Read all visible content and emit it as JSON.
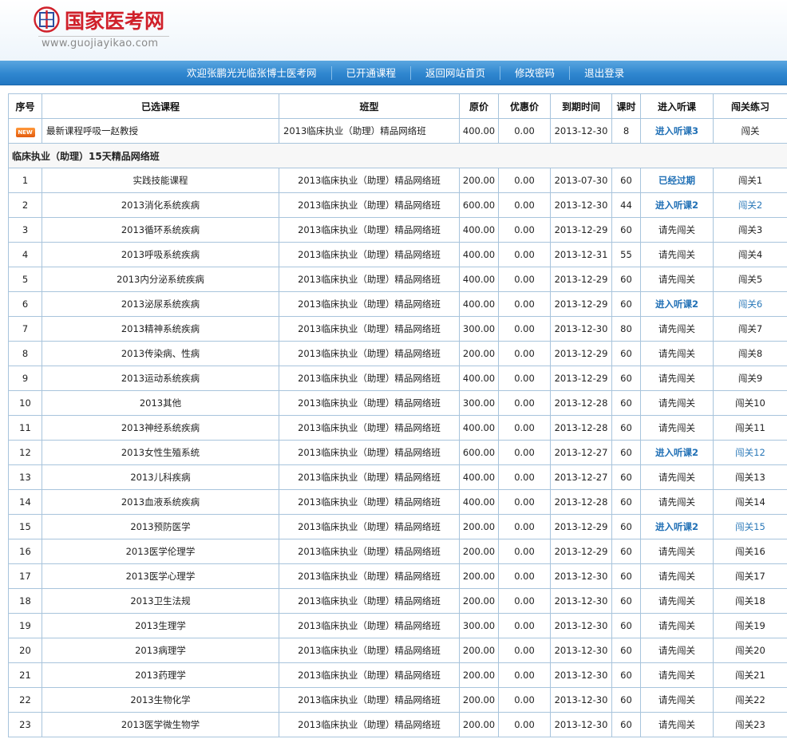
{
  "logo": {
    "title": "国家医考网",
    "url_text": "www.guojiayikao.com"
  },
  "nav": {
    "items": [
      {
        "label": "欢迎张鹏光光临张博士医考网"
      },
      {
        "label": "已开通课程"
      },
      {
        "label": "返回网站首页"
      },
      {
        "label": "修改密码"
      },
      {
        "label": "退出登录"
      }
    ]
  },
  "colors": {
    "nav_blue": "#2f86cf",
    "link_blue": "#1f6fb5",
    "logo_red": "#d0202a",
    "border": "#a8c4dc"
  },
  "table": {
    "headers": [
      "序号",
      "已选课程",
      "班型",
      "原价",
      "优惠价",
      "到期时间",
      "课时",
      "进入听课",
      "闯关练习"
    ],
    "featured": {
      "badge": "NEW",
      "course": "最新课程呼吸一赵教授",
      "class": "2013临床执业（助理）精品网络班",
      "price": "400.00",
      "discount": "0.00",
      "expiry": "2013-12-30",
      "hours": "8",
      "enter": "进入听课3",
      "gate": "闯关"
    },
    "section_title": "临床执业（助理）15天精品网络班",
    "rows": [
      {
        "no": "1",
        "course": "实践技能课程",
        "class": "2013临床执业（助理）精品网络班",
        "price": "200.00",
        "discount": "0.00",
        "expiry": "2013-07-30",
        "hours": "60",
        "enter": "已经过期",
        "gate": "闯关1"
      },
      {
        "no": "2",
        "course": "2013消化系统疾病",
        "class": "2013临床执业（助理）精品网络班",
        "price": "600.00",
        "discount": "0.00",
        "expiry": "2013-12-30",
        "hours": "44",
        "enter": "进入听课2",
        "gate": "闯关2"
      },
      {
        "no": "3",
        "course": "2013循环系统疾病",
        "class": "2013临床执业（助理）精品网络班",
        "price": "400.00",
        "discount": "0.00",
        "expiry": "2013-12-29",
        "hours": "60",
        "enter": "请先闯关",
        "gate": "闯关3"
      },
      {
        "no": "4",
        "course": "2013呼吸系统疾病",
        "class": "2013临床执业（助理）精品网络班",
        "price": "400.00",
        "discount": "0.00",
        "expiry": "2013-12-31",
        "hours": "55",
        "enter": "请先闯关",
        "gate": "闯关4"
      },
      {
        "no": "5",
        "course": "2013内分泌系统疾病",
        "class": "2013临床执业（助理）精品网络班",
        "price": "400.00",
        "discount": "0.00",
        "expiry": "2013-12-29",
        "hours": "60",
        "enter": "请先闯关",
        "gate": "闯关5"
      },
      {
        "no": "6",
        "course": "2013泌尿系统疾病",
        "class": "2013临床执业（助理）精品网络班",
        "price": "400.00",
        "discount": "0.00",
        "expiry": "2013-12-29",
        "hours": "60",
        "enter": "进入听课2",
        "gate": "闯关6"
      },
      {
        "no": "7",
        "course": "2013精神系统疾病",
        "class": "2013临床执业（助理）精品网络班",
        "price": "300.00",
        "discount": "0.00",
        "expiry": "2013-12-30",
        "hours": "80",
        "enter": "请先闯关",
        "gate": "闯关7"
      },
      {
        "no": "8",
        "course": "2013传染病、性病",
        "class": "2013临床执业（助理）精品网络班",
        "price": "200.00",
        "discount": "0.00",
        "expiry": "2013-12-29",
        "hours": "60",
        "enter": "请先闯关",
        "gate": "闯关8"
      },
      {
        "no": "9",
        "course": "2013运动系统疾病",
        "class": "2013临床执业（助理）精品网络班",
        "price": "400.00",
        "discount": "0.00",
        "expiry": "2013-12-29",
        "hours": "60",
        "enter": "请先闯关",
        "gate": "闯关9"
      },
      {
        "no": "10",
        "course": "2013其他",
        "class": "2013临床执业（助理）精品网络班",
        "price": "300.00",
        "discount": "0.00",
        "expiry": "2013-12-28",
        "hours": "60",
        "enter": "请先闯关",
        "gate": "闯关10"
      },
      {
        "no": "11",
        "course": "2013神经系统疾病",
        "class": "2013临床执业（助理）精品网络班",
        "price": "400.00",
        "discount": "0.00",
        "expiry": "2013-12-28",
        "hours": "60",
        "enter": "请先闯关",
        "gate": "闯关11"
      },
      {
        "no": "12",
        "course": "2013女性生殖系统",
        "class": "2013临床执业（助理）精品网络班",
        "price": "600.00",
        "discount": "0.00",
        "expiry": "2013-12-27",
        "hours": "60",
        "enter": "进入听课2",
        "gate": "闯关12"
      },
      {
        "no": "13",
        "course": "2013儿科疾病",
        "class": "2013临床执业（助理）精品网络班",
        "price": "400.00",
        "discount": "0.00",
        "expiry": "2013-12-27",
        "hours": "60",
        "enter": "请先闯关",
        "gate": "闯关13"
      },
      {
        "no": "14",
        "course": "2013血液系统疾病",
        "class": "2013临床执业（助理）精品网络班",
        "price": "400.00",
        "discount": "0.00",
        "expiry": "2013-12-28",
        "hours": "60",
        "enter": "请先闯关",
        "gate": "闯关14"
      },
      {
        "no": "15",
        "course": "2013预防医学",
        "class": "2013临床执业（助理）精品网络班",
        "price": "200.00",
        "discount": "0.00",
        "expiry": "2013-12-29",
        "hours": "60",
        "enter": "进入听课2",
        "gate": "闯关15"
      },
      {
        "no": "16",
        "course": "2013医学伦理学",
        "class": "2013临床执业（助理）精品网络班",
        "price": "200.00",
        "discount": "0.00",
        "expiry": "2013-12-29",
        "hours": "60",
        "enter": "请先闯关",
        "gate": "闯关16"
      },
      {
        "no": "17",
        "course": "2013医学心理学",
        "class": "2013临床执业（助理）精品网络班",
        "price": "200.00",
        "discount": "0.00",
        "expiry": "2013-12-30",
        "hours": "60",
        "enter": "请先闯关",
        "gate": "闯关17"
      },
      {
        "no": "18",
        "course": "2013卫生法规",
        "class": "2013临床执业（助理）精品网络班",
        "price": "200.00",
        "discount": "0.00",
        "expiry": "2013-12-30",
        "hours": "60",
        "enter": "请先闯关",
        "gate": "闯关18"
      },
      {
        "no": "19",
        "course": "2013生理学",
        "class": "2013临床执业（助理）精品网络班",
        "price": "300.00",
        "discount": "0.00",
        "expiry": "2013-12-30",
        "hours": "60",
        "enter": "请先闯关",
        "gate": "闯关19"
      },
      {
        "no": "20",
        "course": "2013病理学",
        "class": "2013临床执业（助理）精品网络班",
        "price": "200.00",
        "discount": "0.00",
        "expiry": "2013-12-30",
        "hours": "60",
        "enter": "请先闯关",
        "gate": "闯关20"
      },
      {
        "no": "21",
        "course": "2013药理学",
        "class": "2013临床执业（助理）精品网络班",
        "price": "200.00",
        "discount": "0.00",
        "expiry": "2013-12-30",
        "hours": "60",
        "enter": "请先闯关",
        "gate": "闯关21"
      },
      {
        "no": "22",
        "course": "2013生物化学",
        "class": "2013临床执业（助理）精品网络班",
        "price": "200.00",
        "discount": "0.00",
        "expiry": "2013-12-30",
        "hours": "60",
        "enter": "请先闯关",
        "gate": "闯关22"
      },
      {
        "no": "23",
        "course": "2013医学微生物学",
        "class": "2013临床执业（助理）精品网络班",
        "price": "200.00",
        "discount": "0.00",
        "expiry": "2013-12-30",
        "hours": "60",
        "enter": "请先闯关",
        "gate": "闯关23"
      }
    ],
    "active_enter_labels": [
      "进入听课2",
      "进入听课3",
      "已经过期"
    ]
  }
}
